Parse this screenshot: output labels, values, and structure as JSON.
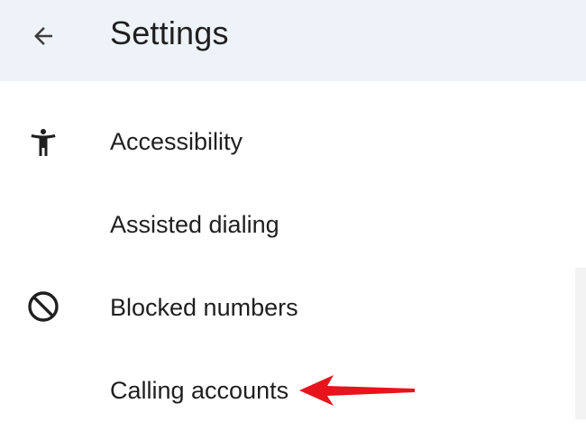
{
  "header": {
    "title": "Settings",
    "back_icon": "arrow-back-icon",
    "background": "#eef2f9"
  },
  "settings": {
    "items": [
      {
        "label": "Accessibility",
        "icon": "accessibility-icon"
      },
      {
        "label": "Assisted dialing",
        "icon": ""
      },
      {
        "label": "Blocked numbers",
        "icon": "block-icon"
      },
      {
        "label": "Calling accounts",
        "icon": ""
      }
    ]
  },
  "annotation": {
    "arrow_color": "#e8141b"
  }
}
